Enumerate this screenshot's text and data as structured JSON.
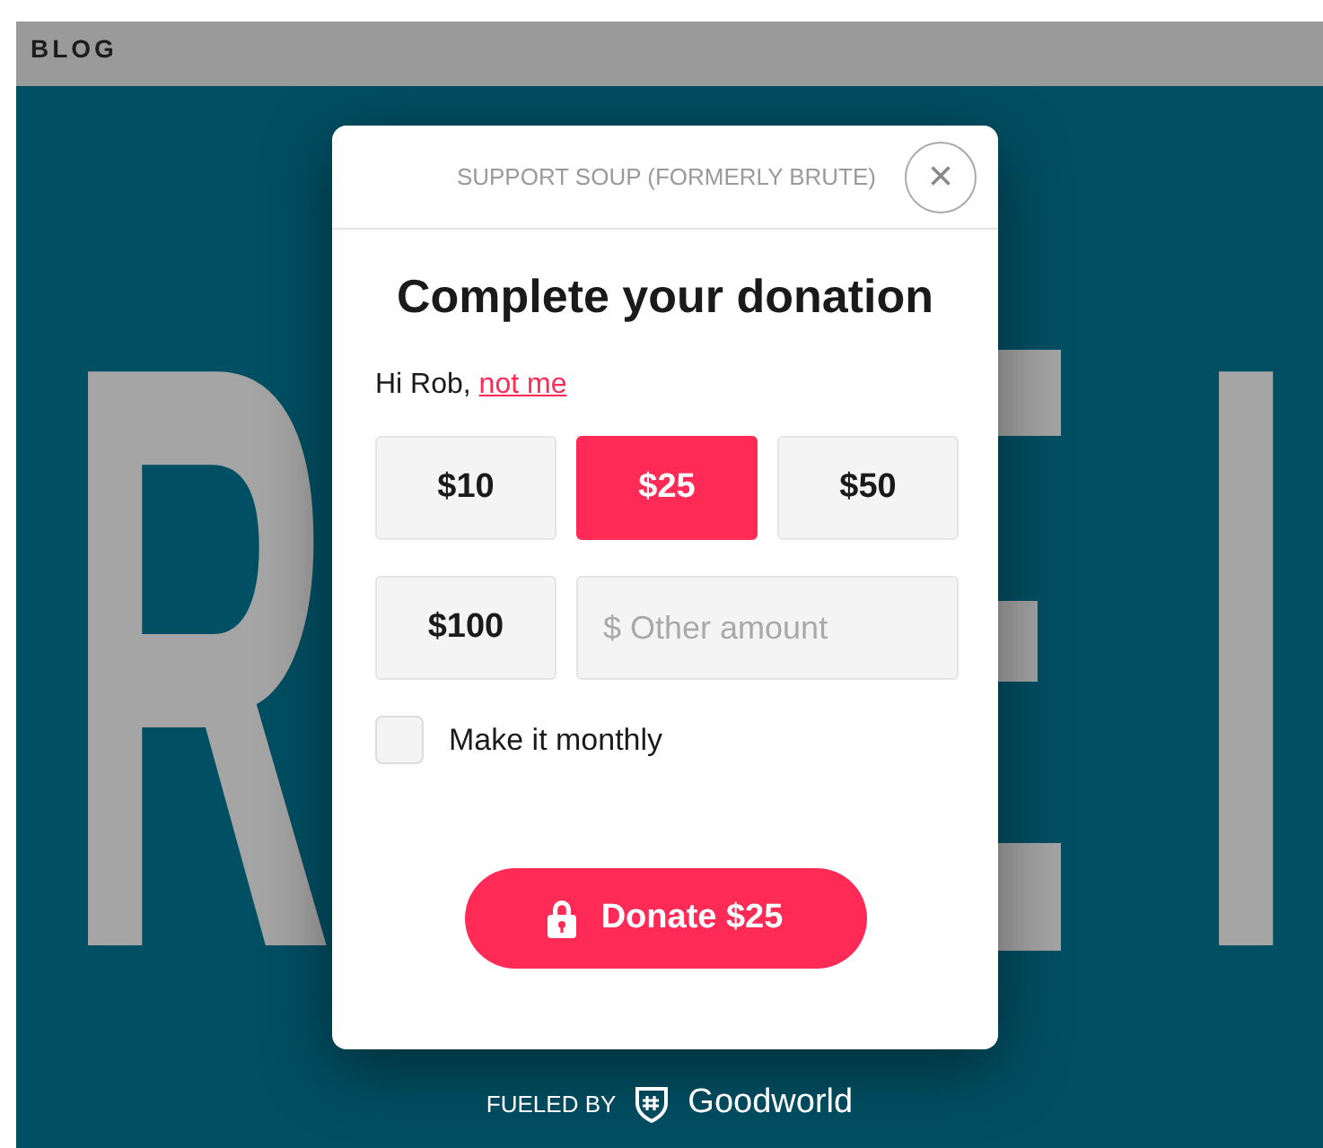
{
  "site_nav": {
    "label": "BLOG"
  },
  "hero_letters": [
    "R",
    "I"
  ],
  "modal": {
    "header": "SUPPORT SOUP (FORMERLY BRUTE)",
    "close": "×",
    "title": "Complete your donation",
    "greeting": "Hi Rob,",
    "switch_user_link": "not me",
    "amounts": [
      {
        "label": "$10",
        "selected": false
      },
      {
        "label": "$25",
        "selected": true
      },
      {
        "label": "$50",
        "selected": false
      },
      {
        "label": "$100",
        "selected": false
      }
    ],
    "other_amount": {
      "placeholder": "$ Other amount"
    },
    "monthly": {
      "label": "Make it monthly",
      "checked": false
    },
    "donate_button": "Donate $25"
  },
  "footer": {
    "prefix": "FUELED BY",
    "brand": "Goodworld"
  }
}
